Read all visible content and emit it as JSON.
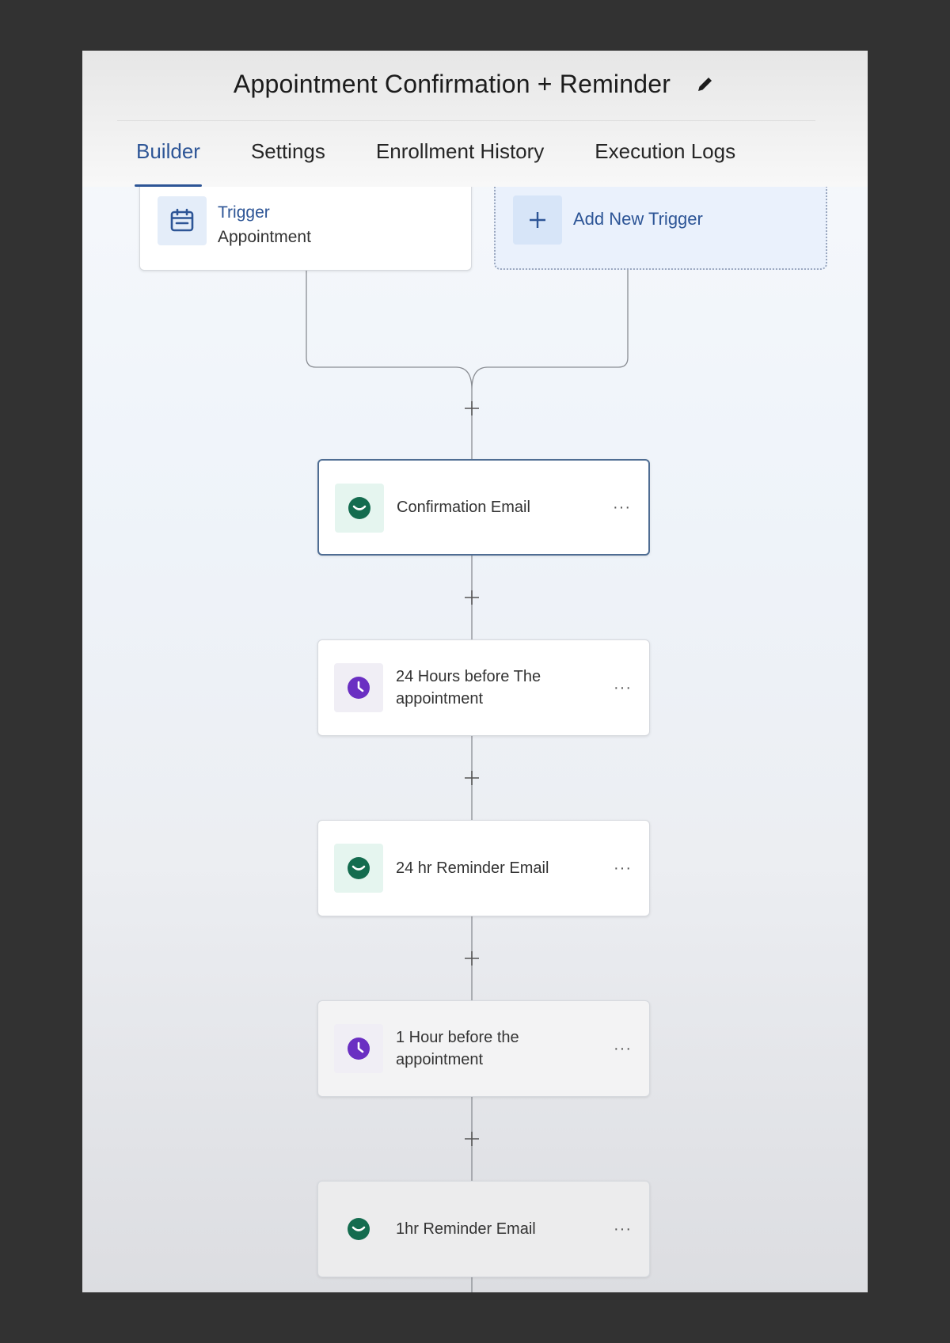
{
  "header": {
    "title": "Appointment Confirmation + Reminder",
    "edit_icon": "pencil-icon"
  },
  "tabs": [
    {
      "label": "Builder",
      "active": true
    },
    {
      "label": "Settings",
      "active": false
    },
    {
      "label": "Enrollment History",
      "active": false
    },
    {
      "label": "Execution Logs",
      "active": false
    }
  ],
  "trigger": {
    "label": "Trigger",
    "value": "Appointment",
    "icon": "calendar-icon"
  },
  "add_trigger": {
    "label": "Add New Trigger",
    "icon": "plus-icon"
  },
  "steps": [
    {
      "label": "Confirmation Email",
      "icon": "email-icon",
      "more": "···"
    },
    {
      "label": "24 Hours before The appointment",
      "icon": "clock-icon",
      "more": "···"
    },
    {
      "label": "24 hr Reminder Email",
      "icon": "email-icon",
      "more": "···"
    },
    {
      "label": "1 Hour before the appointment",
      "icon": "clock-icon",
      "more": "···"
    },
    {
      "label": "1hr Reminder Email",
      "icon": "email-icon",
      "more": "···"
    }
  ],
  "colors": {
    "accent": "#2d5596",
    "email_icon": "#146c4f",
    "clock_icon": "#6a2fc2",
    "outer_background": "#323232"
  }
}
